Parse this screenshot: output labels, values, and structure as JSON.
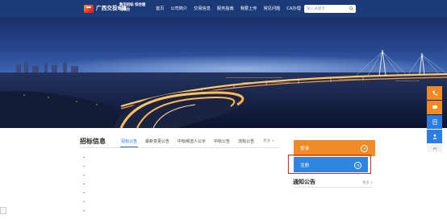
{
  "header": {
    "logo_cn": "广西交投E链",
    "logo_en": "",
    "logo_sub": "数字招标 综合服务平台",
    "nav": [
      "首页",
      "公司简介",
      "交易信息",
      "服务指南",
      "我要上传",
      "常见问题",
      "CA办理"
    ],
    "search_placeholder": "输入关键字"
  },
  "float_bar": {
    "items": [
      {
        "label": "",
        "icon": "phone-icon"
      },
      {
        "label": "",
        "icon": "chat-icon"
      },
      {
        "label": "",
        "icon": "document-icon"
      },
      {
        "label": "",
        "icon": "person-icon"
      },
      {
        "label": "",
        "icon": "arrow-up-icon"
      }
    ]
  },
  "bid": {
    "title": "招标信息",
    "tabs": [
      "招标公告",
      "最新变更公告",
      "中标候选人公示",
      "中标公告",
      "流标公告"
    ],
    "more": "更多 >",
    "rows": [
      {
        "text": "",
        "date": ""
      },
      {
        "text": "",
        "date": ""
      },
      {
        "text": "",
        "date": ""
      },
      {
        "text": "",
        "date": ""
      },
      {
        "text": "",
        "date": ""
      },
      {
        "text": "",
        "date": ""
      },
      {
        "text": "",
        "date": ""
      }
    ]
  },
  "auth": {
    "login_label": "登录",
    "register_label": "注册"
  },
  "notices": {
    "title": "通知公告",
    "more": "更多 >",
    "rows": [
      {
        "text": ""
      },
      {
        "text": ""
      },
      {
        "text": ""
      }
    ]
  },
  "status": {
    "url": ""
  },
  "colors": {
    "header_bg": "#1d3a78",
    "accent_blue": "#2a6fd6",
    "login_orange": "#f08a24",
    "register_blue": "#2f86de",
    "highlight_red": "#e0252b"
  }
}
